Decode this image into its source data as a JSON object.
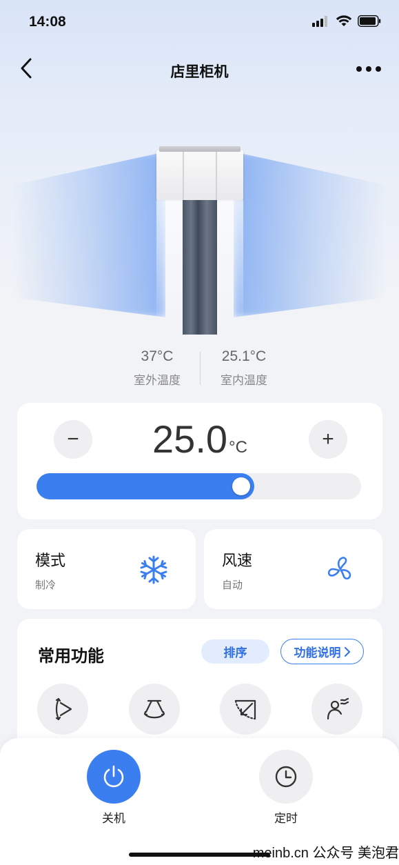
{
  "status_bar": {
    "time": "14:08"
  },
  "nav": {
    "title": "店里柜机"
  },
  "temperatures": {
    "outdoor": {
      "value": "37°C",
      "label": "室外温度"
    },
    "indoor": {
      "value": "25.1°C",
      "label": "室内温度"
    }
  },
  "setpoint": {
    "value": "25.0",
    "unit": "°C",
    "decrease_label": "−",
    "increase_label": "+",
    "slider_fraction": 0.67
  },
  "mode": {
    "title": "模式",
    "value": "制冷",
    "icon": "snowflake-icon"
  },
  "fan_speed": {
    "title": "风速",
    "value": "自动",
    "icon": "fan-icon"
  },
  "functions": {
    "title": "常用功能",
    "sort_label": "排序",
    "help_label": "功能说明",
    "items": [
      {
        "icon": "swing-horizontal-icon"
      },
      {
        "icon": "swing-vertical-icon"
      },
      {
        "icon": "wind-direction-icon"
      },
      {
        "icon": "anti-direct-wind-icon"
      }
    ]
  },
  "bottom_bar": {
    "power_label": "关机",
    "timer_label": "定时"
  },
  "colors": {
    "accent": "#3b7ef0",
    "background_top": "#d9e4f7",
    "card": "#ffffff"
  },
  "watermark": "meinb.cn  公众号 美泡君"
}
